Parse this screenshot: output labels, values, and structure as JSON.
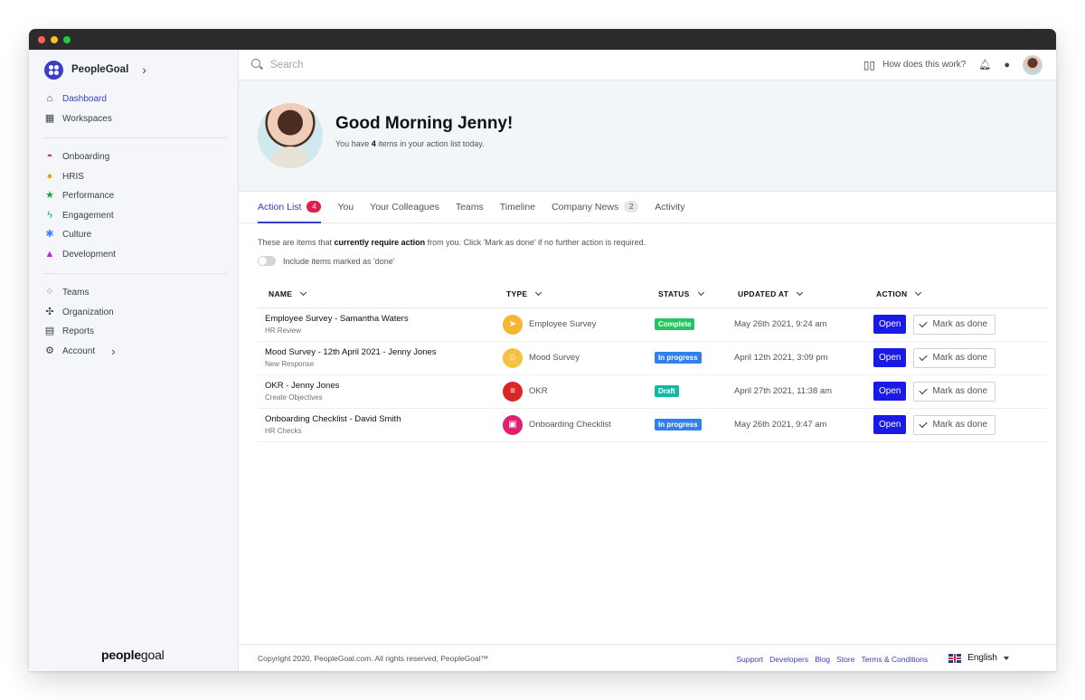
{
  "colors": {
    "accent": "#3b3cc8",
    "complete": "#22c55e",
    "in_progress": "#2f80ed",
    "draft": "#14b8a6",
    "open_button": "#1a1ae6"
  },
  "sidebar": {
    "brand": "PeopleGoal",
    "group1": [
      {
        "label": "Dashboard",
        "icon": "home-icon"
      },
      {
        "label": "Workspaces",
        "icon": "grid-icon"
      }
    ],
    "group2": [
      {
        "label": "Onboarding",
        "icon": "onboarding-icon"
      },
      {
        "label": "HRIS",
        "icon": "hris-icon"
      },
      {
        "label": "Performance",
        "icon": "star-icon"
      },
      {
        "label": "Engagement",
        "icon": "bolt-icon"
      },
      {
        "label": "Culture",
        "icon": "asterisk-icon"
      },
      {
        "label": "Development",
        "icon": "graduation-icon"
      }
    ],
    "group3": [
      {
        "label": "Teams",
        "icon": "teams-icon"
      },
      {
        "label": "Organization",
        "icon": "organization-icon"
      },
      {
        "label": "Reports",
        "icon": "reports-icon"
      },
      {
        "label": "Account",
        "icon": "gear-icon"
      }
    ],
    "logo": {
      "bold": "people",
      "light": "goal"
    }
  },
  "topbar": {
    "search_placeholder": "Search",
    "help": "How does this work?"
  },
  "hero": {
    "title": "Good Morning Jenny!",
    "sub_pre": "You have ",
    "sub_count": "4",
    "sub_post": " items in your action list today."
  },
  "tabs": [
    {
      "label": "Action List",
      "badge": "4"
    },
    {
      "label": "You"
    },
    {
      "label": "Your Colleagues"
    },
    {
      "label": "Teams"
    },
    {
      "label": "Timeline"
    },
    {
      "label": "Company News",
      "badge": "2"
    },
    {
      "label": "Activity"
    }
  ],
  "info": {
    "pre": "These are items that ",
    "bold": "currently require action",
    "post": " from you. Click 'Mark as done' if no further action is required."
  },
  "toggle_label": "Include items marked as 'done'",
  "table": {
    "headers": [
      "NAME",
      "TYPE",
      "STATUS",
      "UPDATED AT",
      "ACTION"
    ],
    "open_label": "Open",
    "done_label": "Mark as done",
    "rows": [
      {
        "name": "Employee Survey - Samantha Waters",
        "sub": "HR Review",
        "type": "Employee Survey",
        "type_icon": "send-icon",
        "type_color": "#f5b731",
        "status": "Complete",
        "status_color": "#22c55e",
        "updated": "May 26th 2021, 9:24 am"
      },
      {
        "name": "Mood Survey - 12th April 2021 - Jenny Jones",
        "sub": "New Response",
        "type": "Mood Survey",
        "type_icon": "smile-icon",
        "type_color": "#f5c242",
        "status": "In progress",
        "status_color": "#2f80ed",
        "updated": "April 12th 2021, 3:09 pm"
      },
      {
        "name": "OKR - Jenny Jones",
        "sub": "Create Objectives",
        "type": "OKR",
        "type_icon": "list-icon",
        "type_color": "#dc2626",
        "status": "Draft",
        "status_color": "#14b8a6",
        "updated": "April 27th 2021, 11:38 am"
      },
      {
        "name": "Onboarding Checklist - David Smith",
        "sub": "HR Checks",
        "type": "Onboarding Checklist",
        "type_icon": "clipboard-icon",
        "type_color": "#e11d74",
        "status": "In progress",
        "status_color": "#2f80ed",
        "updated": "May 26th 2021, 9:47 am"
      }
    ]
  },
  "footer": {
    "copyright": "Copyright 2020, PeopleGoal.com. All rights reserved, PeopleGoal™",
    "links": [
      "Support",
      "Developers",
      "Blog",
      "Store",
      "Terms & Conditions"
    ],
    "language": "English"
  }
}
